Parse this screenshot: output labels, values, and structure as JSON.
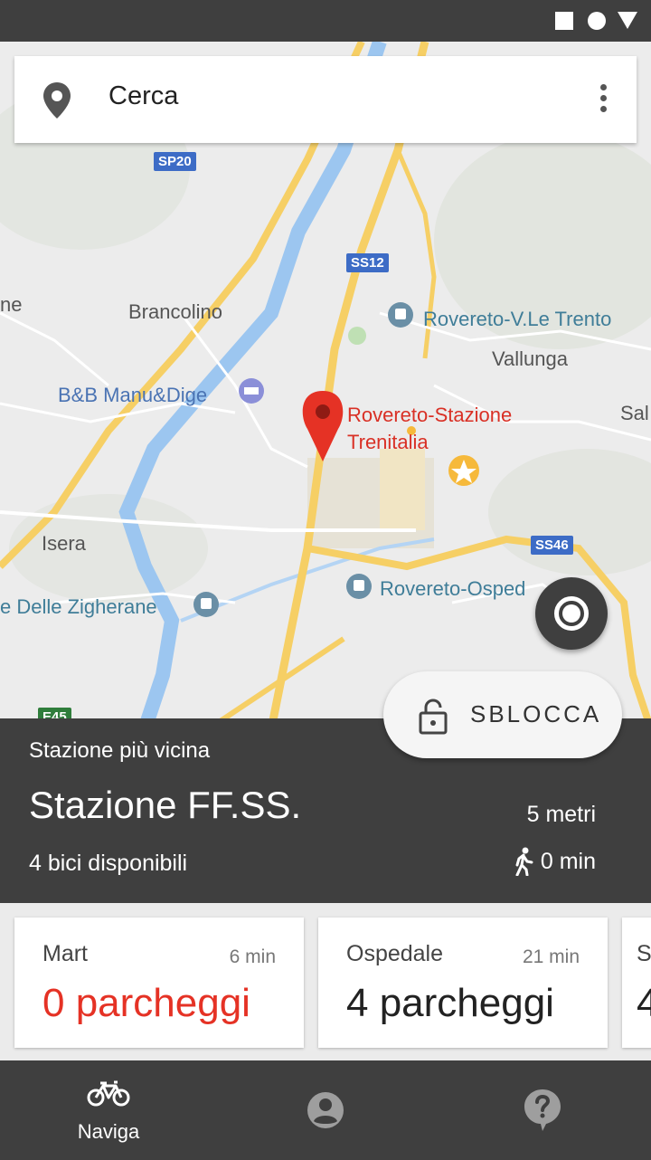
{
  "status_bar": {
    "icons": [
      "square-icon",
      "circle-icon",
      "triangle-icon"
    ]
  },
  "search": {
    "placeholder": "Cerca",
    "icon": "location-pin-icon",
    "menu_icon": "more-vert-icon"
  },
  "map": {
    "labels": {
      "brancolino": "Brancolino",
      "vallunga": "Vallunga",
      "isera": "Isera",
      "bb": "B&B Manu&Dige",
      "trento": "Rovereto-V.Le Trento",
      "ospedale": "Rovereto-Osped",
      "zigherane": "e Delle Zigherane",
      "station_line1": "Rovereto-Stazione",
      "station_line2": "Trenitalia",
      "sal": "Sal",
      "ne": "ne"
    },
    "roads": {
      "sp20": "SP20",
      "ss12": "SS12",
      "ss46": "SS46",
      "e45": "E45"
    }
  },
  "nearest_station": {
    "caption": "Stazione più vicina",
    "name": "Stazione FF.SS.",
    "distance": "5 metri",
    "bikes": "4 bici disponibili",
    "walk_time": "0 min"
  },
  "unlock": {
    "label": "SBLOCCA"
  },
  "parking": [
    {
      "name": "Mart",
      "time": "6 min",
      "count": "0 parcheggi",
      "color": "#e53225"
    },
    {
      "name": "Ospedale",
      "time": "21 min",
      "count": "4 parcheggi",
      "color": "#222222"
    },
    {
      "name": "S",
      "time": "",
      "count": "4",
      "color": "#222222"
    }
  ],
  "nav": {
    "naviga": "Naviga"
  },
  "colors": {
    "dark": "#3f3f3f",
    "accent_red": "#e53225",
    "road_yellow": "#f6cf65",
    "river_blue": "#9cc6f0"
  }
}
